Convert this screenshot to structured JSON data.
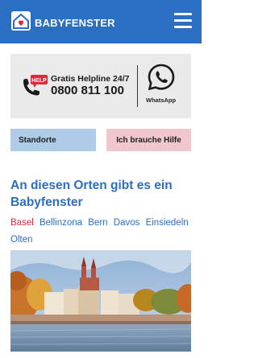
{
  "header": {
    "brand": "BABYFENSTER",
    "logo_icon": "house-heart-icon",
    "menu_icon": "hamburger-menu-icon",
    "bg_color": "#2b6fc3"
  },
  "helpline": {
    "title": "Gratis Helpline 24/7",
    "number": "0800 811 100",
    "phone_badge": "HELP",
    "whatsapp_label": "WhatsApp"
  },
  "buttons": {
    "locations": "Standorte",
    "need_help": "Ich brauche Hilfe"
  },
  "locations_section": {
    "title": "An diesen Orten gibt es ein Babyfenster",
    "places": [
      "Basel",
      "Bellinzona",
      "Bern",
      "Davos",
      "Einsiedeln",
      "Olten"
    ],
    "active_place": "Basel"
  },
  "colors": {
    "accent_blue": "#2b6fc3",
    "active_red": "#e0273b",
    "locations_button": "#aecbe8",
    "help_button": "#f1c7cf"
  }
}
